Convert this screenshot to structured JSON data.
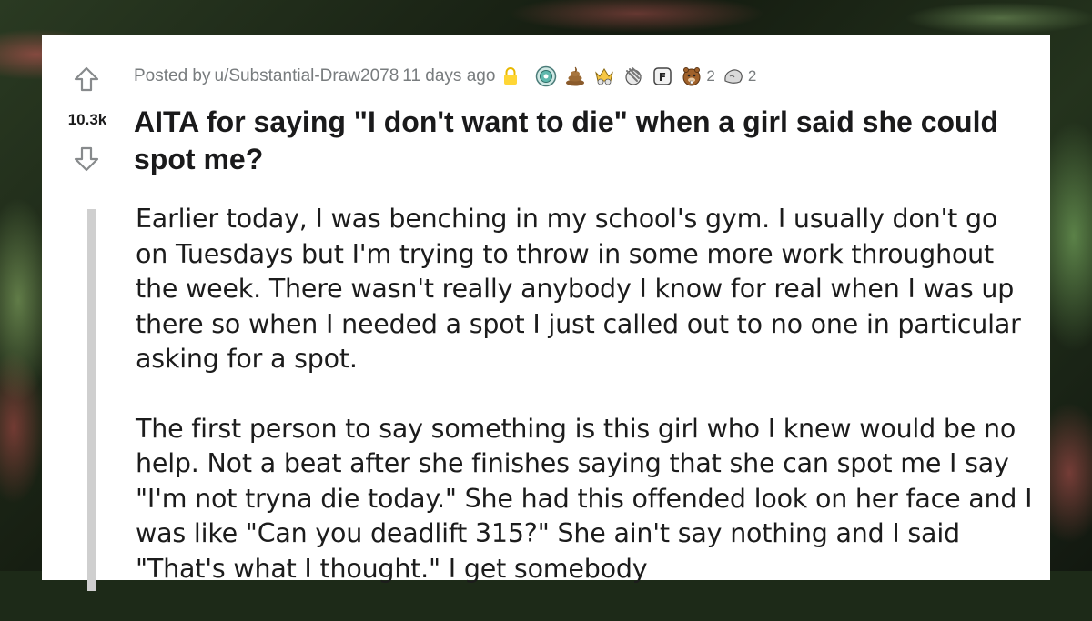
{
  "post": {
    "votes": "10.3k",
    "posted_by_prefix": "Posted by",
    "author": "u/Substantial-Draw2078",
    "time_ago": "11 days ago",
    "title": "AITA for saying \"I don't want to die\" when a girl said she could spot me?",
    "awards": [
      {
        "icon": "wholesome-award-icon",
        "count": ""
      },
      {
        "icon": "poop-award-icon",
        "count": ""
      },
      {
        "icon": "crown-award-icon",
        "count": ""
      },
      {
        "icon": "facepalm-award-icon",
        "count": ""
      },
      {
        "icon": "press-f-award-icon",
        "count": ""
      },
      {
        "icon": "beaver-award-icon",
        "count": "2"
      },
      {
        "icon": "rock-award-icon",
        "count": "2"
      }
    ],
    "paragraphs": [
      "Earlier today, I was benching in my school's gym. I usually don't go on Tuesdays but I'm trying to throw in some more work throughout the week. There wasn't really anybody I know for real when I was up there so when I needed a spot I just called out to no one in particular asking for a spot.",
      "The first person to say something is this girl who I knew would be no help. Not a beat after she finishes saying that she can spot me I say \"I'm not tryna die today.\" She had this offended look on her face and I was like \"Can you deadlift 315?\" She ain't say nothing and I said \"That's what I thought.\" I get somebody"
    ]
  },
  "colors": {
    "upvote": "#878a8c",
    "meta_text": "#787c7e",
    "lock": "#ffd635",
    "title_text": "#1a1a1b"
  }
}
